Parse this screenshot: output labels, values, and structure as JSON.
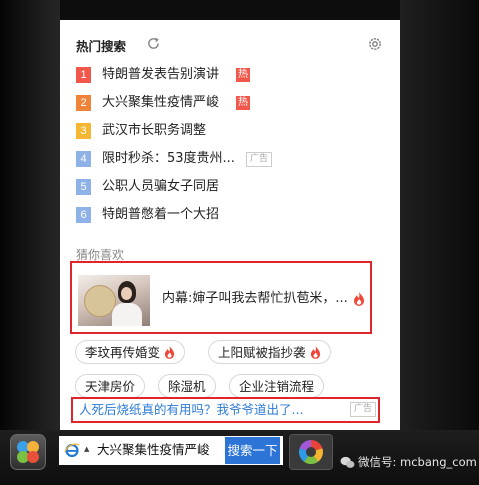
{
  "panel": {
    "title": "热门搜索",
    "hot_badge": "热",
    "ad_badge": "广告",
    "ranks": [
      {
        "num": "1",
        "text": "特朗普发表告别演讲",
        "badge": "hot",
        "color": "#f2574b"
      },
      {
        "num": "2",
        "text": "大兴聚集性疫情严峻",
        "badge": "hot",
        "color": "#f0833a"
      },
      {
        "num": "3",
        "text": "武汉市长职务调整",
        "badge": "",
        "color": "#f5b731"
      },
      {
        "num": "4",
        "text": "限时秒杀：53度贵州...",
        "badge": "ad",
        "color": "#8eb2e8"
      },
      {
        "num": "5",
        "text": "公职人员骗女子同居",
        "badge": "",
        "color": "#8eb2e8"
      },
      {
        "num": "6",
        "text": "特朗普憋着一个大招",
        "badge": "",
        "color": "#8eb2e8"
      }
    ],
    "guess_title": "猜你喜欢",
    "card_title": "内幕:婶子叫我去帮忙扒苞米，...",
    "chips": [
      {
        "text": "李玟再传婚变",
        "hot": true
      },
      {
        "text": "上阳赋被指抄袭",
        "hot": true
      },
      {
        "text": "天津房价",
        "hot": false
      },
      {
        "text": "除湿机",
        "hot": false
      },
      {
        "text": "企业注销流程",
        "hot": false
      }
    ],
    "ad_link": "人死后烧纸真的有用吗？我爷爷道出了...",
    "ad_link_badge": "广告"
  },
  "taskbar": {
    "search_query": "大兴聚集性疫情严峻",
    "search_button": "搜索一下",
    "caret": "▲",
    "watermark": "微信号: mcbang_com"
  },
  "colors": {
    "highlight_border": "#e0242c",
    "link": "#2e7bd6",
    "search_button": "#2d74d7"
  }
}
